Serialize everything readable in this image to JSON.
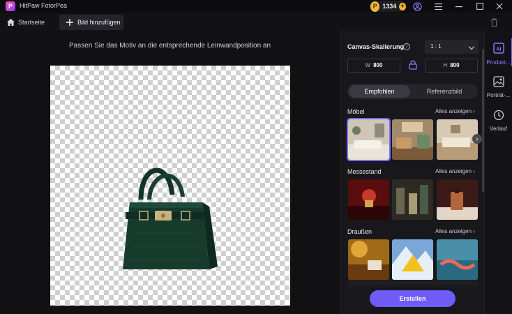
{
  "app": {
    "title": "HitPaw FotorPea",
    "logo_letter": "P",
    "credits": "1334",
    "coin_letter": "P"
  },
  "tabs": {
    "home_label": "Startseite",
    "add_label": "Bild hinzufügen"
  },
  "canvas": {
    "hint": "Passen Sie das Motiv an die entsprechende Leinwandposition an"
  },
  "panel": {
    "scaling_title": "Canvas-Skalierung",
    "ratio_value": "1 : 1",
    "width_label": "W",
    "width_value": "800",
    "height_label": "H",
    "height_value": "800",
    "tab_recommended": "Empfohlen",
    "tab_reference": "Referenzbild",
    "see_all": "Alles anzeigen",
    "categories": [
      {
        "title": "Möbel"
      },
      {
        "title": "Messestand"
      },
      {
        "title": "Draußen"
      }
    ],
    "create_label": "Erstellen"
  },
  "sidenav": {
    "items": [
      {
        "label": "Produkt..."
      },
      {
        "label": "Porträt-..."
      },
      {
        "label": "Verlauf"
      }
    ]
  },
  "colors": {
    "accent": "#6f5cf6",
    "selected_outline": "#7b6bff",
    "coin": "#f3b63a"
  }
}
